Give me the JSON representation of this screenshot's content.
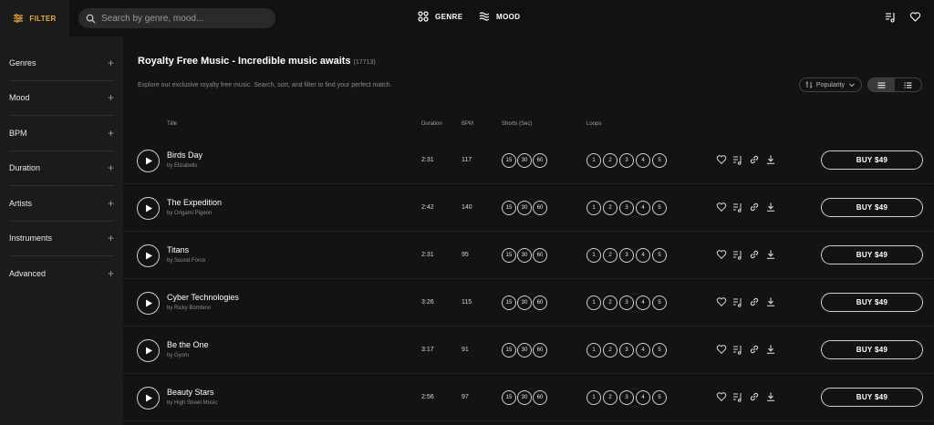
{
  "topbar": {
    "filter_label": "FILTER",
    "search_placeholder": "Search by genre, mood...",
    "nav": [
      {
        "label": "GENRE"
      },
      {
        "label": "MOOD"
      }
    ]
  },
  "sidebar": {
    "items": [
      {
        "label": "Genres"
      },
      {
        "label": "Mood"
      },
      {
        "label": "BPM"
      },
      {
        "label": "Duration"
      },
      {
        "label": "Artists"
      },
      {
        "label": "Instruments"
      },
      {
        "label": "Advanced"
      }
    ],
    "expand_symbol": "+"
  },
  "main": {
    "title": "Royalty Free Music - Incredible music awaits",
    "count": "(17713)",
    "subtitle": "Explore our exclusive royalty free music. Search, sort, and filter to find your perfect match.",
    "sort_label": "Popularity"
  },
  "columns": {
    "title": "Title",
    "duration": "Duration",
    "bpm": "BPM",
    "shorts": "Shorts (Sec)",
    "loops": "Loops"
  },
  "shorts_options": [
    "15",
    "30",
    "60"
  ],
  "loop_options": [
    "1",
    "2",
    "3",
    "4",
    "5"
  ],
  "tracks": [
    {
      "title": "Birds Day",
      "artist": "by Elizabells",
      "duration": "2:31",
      "bpm": "117",
      "price": "BUY $49"
    },
    {
      "title": "The Expedition",
      "artist": "by Origami Pigeon",
      "duration": "2:42",
      "bpm": "140",
      "price": "BUY $49"
    },
    {
      "title": "Titans",
      "artist": "by Sound Force",
      "duration": "2:31",
      "bpm": "95",
      "price": "BUY $49"
    },
    {
      "title": "Cyber Technologies",
      "artist": "by Ricky Bombino",
      "duration": "3:26",
      "bpm": "115",
      "price": "BUY $49"
    },
    {
      "title": "Be the One",
      "artist": "by Gyom",
      "duration": "3:17",
      "bpm": "91",
      "price": "BUY $49"
    },
    {
      "title": "Beauty Stars",
      "artist": "by High Street Music",
      "duration": "2:56",
      "bpm": "97",
      "price": "BUY $49"
    }
  ],
  "colors": {
    "accent": "#f0a940",
    "background": "#131313",
    "sidebar": "#1b1b1b"
  },
  "icons": [
    "filter-icon",
    "search-icon",
    "genre-icon",
    "mood-icon",
    "playlist-icon",
    "heart-icon",
    "play-icon",
    "similar-icon",
    "link-icon",
    "download-icon",
    "sort-icon",
    "list-view-icon",
    "compact-view-icon"
  ]
}
